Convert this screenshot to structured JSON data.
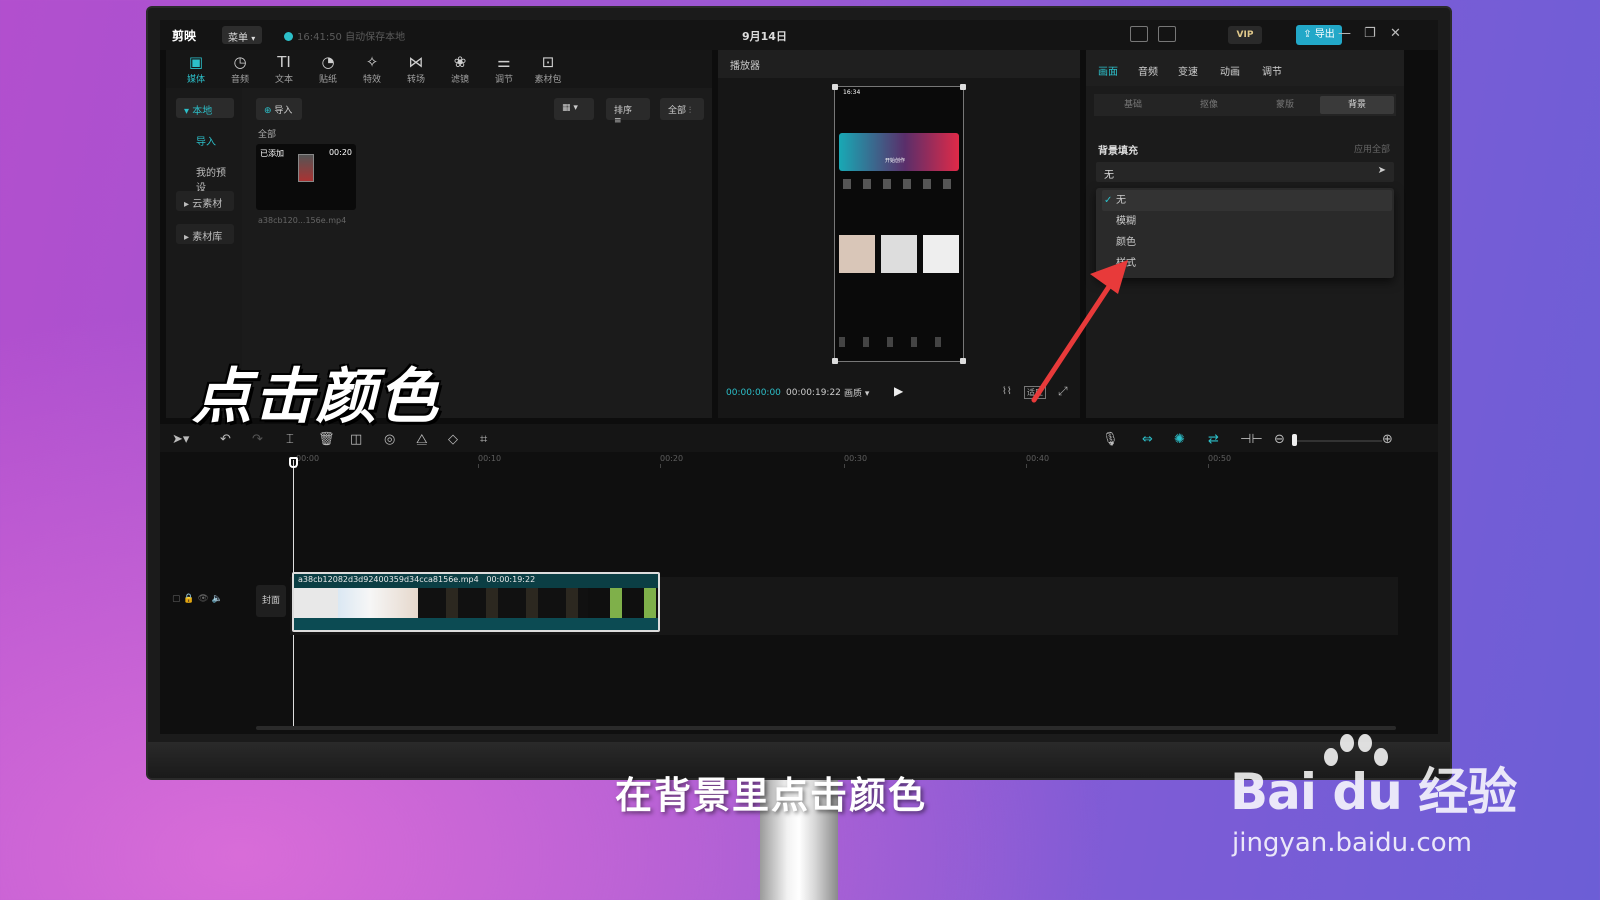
{
  "app": {
    "logo": "剪映",
    "menu_label": "菜单",
    "autosave": "16:41:50 自动保存本地",
    "title": "9月14日",
    "vip": "VIP",
    "export_label": "导出"
  },
  "toolbar": {
    "items": [
      {
        "label": "媒体",
        "icon": "media-icon"
      },
      {
        "label": "音频",
        "icon": "audio-icon"
      },
      {
        "label": "文本",
        "icon": "text-icon"
      },
      {
        "label": "贴纸",
        "icon": "sticker-icon"
      },
      {
        "label": "特效",
        "icon": "effects-icon"
      },
      {
        "label": "转场",
        "icon": "transition-icon"
      },
      {
        "label": "滤镜",
        "icon": "filter-icon"
      },
      {
        "label": "调节",
        "icon": "adjust-icon"
      },
      {
        "label": "素材包",
        "icon": "package-icon"
      }
    ]
  },
  "sidebar": {
    "local": "本地",
    "import": "导入",
    "presets": "我的预设",
    "cloud": "云素材",
    "library": "素材库"
  },
  "media": {
    "import_button": "导入",
    "all_label": "全部",
    "sort_label": "排序",
    "filter_label": "全部",
    "clip": {
      "badge": "已添加",
      "duration": "00:20",
      "filename": "a38cb120...156e.mp4"
    }
  },
  "player": {
    "title": "播放器",
    "current_time": "00:00:00:00",
    "total_time": "00:00:19:22",
    "ratio_label": "画质",
    "fit_label": "适应",
    "phone_time": "16:34",
    "phone_banner": "开始创作"
  },
  "inspector": {
    "tabs": [
      "画面",
      "音频",
      "变速",
      "动画",
      "调节"
    ],
    "subtabs": [
      "基础",
      "抠像",
      "蒙版",
      "背景"
    ],
    "bg_fill_label": "背景填充",
    "apply_all": "应用全部",
    "selected_value": "无",
    "options": [
      "无",
      "模糊",
      "颜色",
      "样式"
    ]
  },
  "timeline": {
    "ruler": [
      "00:00",
      "00:10",
      "00:20",
      "00:30",
      "00:40",
      "00:50"
    ],
    "cover_label": "封面",
    "clip_name": "a38cb12082d3d92400359d34cca8156e.mp4",
    "clip_duration": "00:00:19:22"
  },
  "captions": {
    "overlay": "点击颜色",
    "subtitle": "在背景里点击颜色"
  },
  "watermark": {
    "brand": "Bai du 经验",
    "url": "jingyan.baidu.com"
  },
  "colors": {
    "accent": "#2cbfc9",
    "arrow": "#e83a3a",
    "panel": "#1b1b1b"
  }
}
